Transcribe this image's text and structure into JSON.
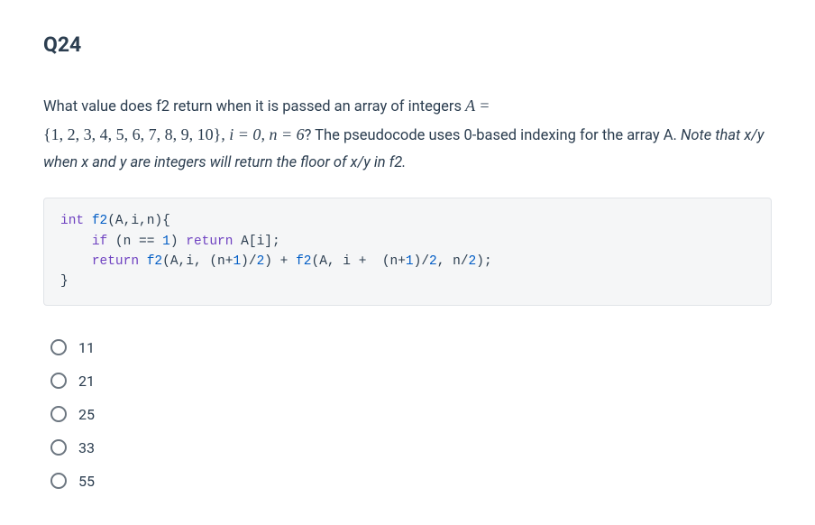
{
  "question": {
    "number": "Q24",
    "prompt_parts": {
      "p1": "What value does f2 return when it is passed an array of integers ",
      "arr_eq": "A =",
      "arr_set": "{1, 2, 3, 4, 5, 6, 7, 8, 9, 10}",
      "ieq": ", i = 0",
      "neq": ", n = 6",
      "p2": "? The pseudocode uses 0-based indexing for the array A. ",
      "note": "Note that x/y when x and y are integers will return the floor of x/y in f2."
    },
    "code": "int f2(A,i,n){\n    if (n == 1) return A[i];\n    return f2(A,i, (n+1)/2) + f2(A, i +  (n+1)/2, n/2);\n}",
    "options": [
      {
        "label": "11"
      },
      {
        "label": "21"
      },
      {
        "label": "25"
      },
      {
        "label": "33"
      },
      {
        "label": "55"
      }
    ]
  }
}
